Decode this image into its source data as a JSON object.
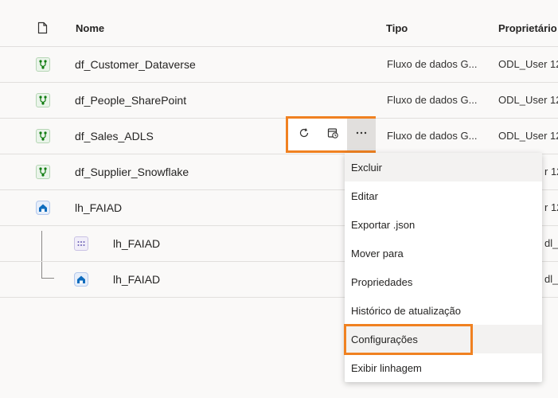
{
  "header": {
    "name_label": "Nome",
    "type_label": "Tipo",
    "owner_label": "Proprietário"
  },
  "rows": [
    {
      "name": "df_Customer_Dataverse",
      "type": "Fluxo de dados G...",
      "owner": "ODL_User 12"
    },
    {
      "name": "df_People_SharePoint",
      "type": "Fluxo de dados G...",
      "owner": "ODL_User 12"
    },
    {
      "name": "df_Sales_ADLS",
      "type": "Fluxo de dados G...",
      "owner": "ODL_User 12"
    },
    {
      "name": "df_Supplier_Snowflake",
      "type": "",
      "owner": "r 12"
    },
    {
      "name": "lh_FAIAD",
      "type": "",
      "owner": "r 12"
    },
    {
      "name": "lh_FAIAD",
      "type": "",
      "owner": "dl_u"
    },
    {
      "name": "lh_FAIAD",
      "type": "",
      "owner": "dl_u"
    }
  ],
  "context_menu": {
    "items": [
      "Excluir",
      "Editar",
      "Exportar .json",
      "Mover para",
      "Propriedades",
      "Histórico de atualização",
      "Configurações",
      "Exibir linhagem"
    ]
  },
  "colors": {
    "highlight": "#f08121",
    "dataflow_icon": "#107c10",
    "lakehouse_icon": "#0f6cbd",
    "semantic_icon": "#6b5fb5"
  },
  "icons": {
    "file_header": "document-icon",
    "refresh": "refresh-icon",
    "schedule": "schedule-icon",
    "more": "more-options-icon"
  }
}
